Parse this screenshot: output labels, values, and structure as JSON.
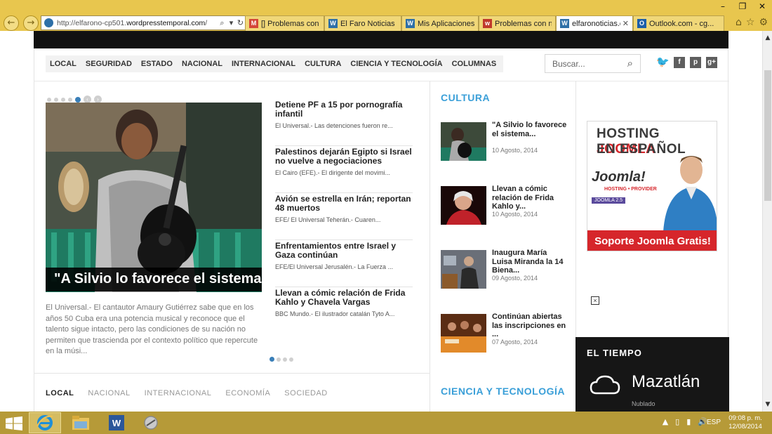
{
  "window_controls": {
    "minimize": "–",
    "maximize": "❐",
    "close": "✕"
  },
  "browser": {
    "back_icon": "←",
    "forward_icon": "→",
    "address": {
      "prefix": "http://elfarono-cp501.",
      "domain": "wordpresstemporal.com",
      "suffix": "/"
    },
    "tabs": [
      {
        "label": "[] Problemas con n...",
        "icon": "gmail-icon",
        "color": "#d44638",
        "glyph": "M"
      },
      {
        "label": "El Faro Noticias - A...",
        "icon": "wordpress-icon",
        "color": "#2e6fa7",
        "glyph": "W"
      },
      {
        "label": "Mis Aplicaciones (...",
        "icon": "wordpress-icon",
        "color": "#2e6fa7",
        "glyph": "W"
      },
      {
        "label": "Problemas con no...",
        "icon": "app-icon",
        "color": "#c0392b",
        "glyph": "w"
      },
      {
        "label": "elfaronoticias.c...",
        "icon": "wordpress-icon",
        "color": "#2e6fa7",
        "glyph": "W"
      },
      {
        "label": "Outlook.com - cg...",
        "icon": "outlook-icon",
        "color": "#1e5fa8",
        "glyph": "O"
      }
    ]
  },
  "site": {
    "nav": [
      "LOCAL",
      "SEGURIDAD",
      "ESTADO",
      "NACIONAL",
      "INTERNACIONAL",
      "CULTURA",
      "CIENCIA Y TECNOLOGÍA",
      "COLUMNAS"
    ],
    "search_placeholder": "Buscar...",
    "social": {
      "twitter": "🐦",
      "facebook": "f",
      "pinterest": "p",
      "googleplus": "g+"
    },
    "featured": {
      "title": "\"A Silvio lo favorece el sistema\"",
      "excerpt": "El Universal.- El cantautor Amaury Gutiérrez sabe que en los años 50 Cuba era una potencia musical y reconoce que el talento sigue intacto, pero las condiciones de su nación no permiten que trascienda por el contexto político que repercute en la músi..."
    },
    "news": [
      {
        "title": "Detiene PF a 15 por pornografía infantil",
        "excerpt": "El Universal.- Las detenciones fueron re..."
      },
      {
        "title": "Palestinos dejarán Egipto si Israel no vuelve a negociaciones",
        "excerpt": "El Cairo (EFE).- El dirigente del movimi..."
      },
      {
        "title": "Avión se estrella en Irán; reportan 48 muertos",
        "excerpt": "EFE/ El Universal Teherán.- Cuaren..."
      },
      {
        "title": "Enfrentamientos entre Israel y Gaza continúan",
        "excerpt": "EFE/El Universal Jerusalén.- La Fuerza ..."
      },
      {
        "title": "Llevan a cómic relación de Frida Kahlo y Chavela Vargas",
        "excerpt": "BBC Mundo.- El ilustrador catalán Tyto A..."
      }
    ],
    "subtabs": [
      "LOCAL",
      "NACIONAL",
      "INTERNACIONAL",
      "ECONOMÍA",
      "SOCIEDAD"
    ],
    "cultura": {
      "heading": "CULTURA",
      "items": [
        {
          "title": "\"A Silvio lo favorece el sistema...",
          "date": "10 Agosto, 2014"
        },
        {
          "title": "Llevan a cómic relación de Frida Kahlo y...",
          "date": "10 Agosto, 2014"
        },
        {
          "title": "Inaugura María Luisa Miranda la 14 Biena...",
          "date": "09 Agosto, 2014"
        },
        {
          "title": "Continúan abiertas las inscripciones en ...",
          "date": "07 Agosto, 2014"
        }
      ]
    },
    "ciencia_heading": "CIENCIA Y TECNOLOGÍA",
    "ad": {
      "line1_a": "HOSTING ",
      "line1_b": "JOOMLA",
      "line2": "EN ESPAÑOL",
      "logo": "Joomla!",
      "logo_sub": "HOSTING • PROVIDER",
      "version": "JOOMLA 2.5",
      "band": "Soporte Joomla Gratis!"
    },
    "weather": {
      "heading": "EL TIEMPO",
      "city": "Mazatlán",
      "condition": "Nublado"
    }
  },
  "taskbar": {
    "lang": "ESP",
    "time": "09:08 p. m.",
    "date": "12/08/2014"
  }
}
